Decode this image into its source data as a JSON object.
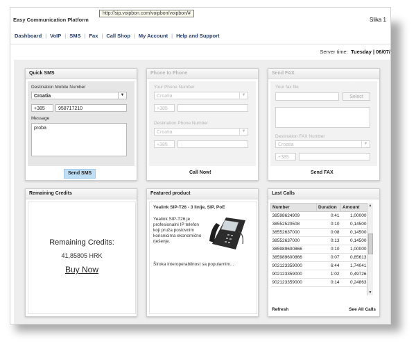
{
  "header": {
    "brand": "Easy Communication Platform",
    "url": "http://sip.voipbon.com/voipbon/voipbon/#",
    "caption": "Slika 1"
  },
  "nav": [
    {
      "label": "Dashboard",
      "name": "nav-dashboard"
    },
    {
      "label": "VoIP",
      "name": "nav-voip"
    },
    {
      "label": "SMS",
      "name": "nav-sms"
    },
    {
      "label": "Fax",
      "name": "nav-fax"
    },
    {
      "label": "Call Shop",
      "name": "nav-call-shop"
    },
    {
      "label": "My Account",
      "name": "nav-my-account"
    },
    {
      "label": "Help and Support",
      "name": "nav-help-and-support"
    }
  ],
  "server": {
    "label": "Server time:",
    "value": "Tuesday | 06/07/"
  },
  "quick_sms": {
    "title": "Quick SMS",
    "dest_label": "Destination Mobile Number",
    "country": "Croatia",
    "prefix": "+385",
    "number": "958717210",
    "message_label": "Message",
    "message": "proba",
    "send": "Send SMS"
  },
  "phone_to_phone": {
    "title": "Phone to Phone",
    "your_label": "Your Phone Number",
    "country1": "Croatia",
    "prefix1": "+385",
    "dest_label": "Destination Phone Number",
    "country2": "Croatia",
    "prefix2": "+385",
    "action": "Call Now!"
  },
  "send_fax": {
    "title": "Send FAX",
    "file_label": "Your fax file",
    "select": "Select",
    "dest_label": "Destination FAX Number",
    "country": "Croatia",
    "prefix": "+385",
    "action": "Send FAX"
  },
  "credits": {
    "title": "Remaining Credits",
    "big_label": "Remaining Credits:",
    "amount": "41,85805 HRK",
    "buy": "Buy Now"
  },
  "featured": {
    "title": "Featured product",
    "product": "Yealink SIP-T26 - 3 linije, SIP, PoE",
    "desc": "Yealink SIP-T26 je profesionalni IP telefon koji pruža poslovnim korisnicima ekonomično rješenje.",
    "desc2": "Široka interoperabilnost sa popularnim..."
  },
  "last_calls": {
    "title": "Last Calls",
    "columns": [
      "Number",
      "Duration",
      "Amount"
    ],
    "rows": [
      [
        "38598624909",
        "0:41",
        "1,00000"
      ],
      [
        "38552520508",
        "0:10",
        "0,14500"
      ],
      [
        "38552637000",
        "0:08",
        "0,14500"
      ],
      [
        "38552637000",
        "0:13",
        "0,14500"
      ],
      [
        "385989600866",
        "0:10",
        "1,00000"
      ],
      [
        "385989600866",
        "0:07",
        "0,85613"
      ],
      [
        "902123359000",
        "6:44",
        "1,74041"
      ],
      [
        "902123359000",
        "1:02",
        "0,49726"
      ],
      [
        "902123359000",
        "0:14",
        "0,24863"
      ]
    ],
    "refresh": "Refresh",
    "see_all": "See All Calls"
  }
}
